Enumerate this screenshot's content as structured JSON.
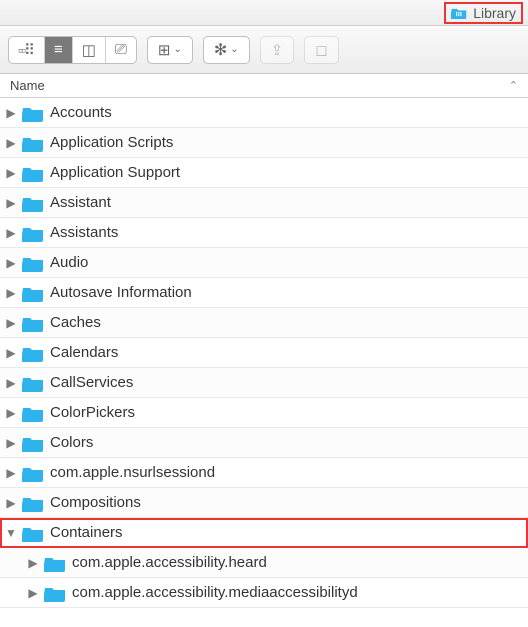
{
  "title": "Library",
  "colors": {
    "folder": "#2fb3ec",
    "accent": "#e33",
    "toolbar_icon": "#666"
  },
  "toolbar": {
    "views": [
      {
        "name": "icon-view",
        "active": false
      },
      {
        "name": "list-view",
        "active": true
      },
      {
        "name": "column-view",
        "active": false
      },
      {
        "name": "coverflow-view",
        "active": false
      }
    ],
    "arrange": {
      "name": "arrange-button"
    },
    "action": {
      "name": "action-button"
    },
    "share": {
      "name": "share-button",
      "disabled": true
    },
    "tags": {
      "name": "tags-button",
      "disabled": true
    }
  },
  "header": {
    "name_label": "Name"
  },
  "rows": [
    {
      "label": "Accounts",
      "depth": 0,
      "expanded": false
    },
    {
      "label": "Application Scripts",
      "depth": 0,
      "expanded": false
    },
    {
      "label": "Application Support",
      "depth": 0,
      "expanded": false
    },
    {
      "label": "Assistant",
      "depth": 0,
      "expanded": false
    },
    {
      "label": "Assistants",
      "depth": 0,
      "expanded": false
    },
    {
      "label": "Audio",
      "depth": 0,
      "expanded": false
    },
    {
      "label": "Autosave Information",
      "depth": 0,
      "expanded": false
    },
    {
      "label": "Caches",
      "depth": 0,
      "expanded": false
    },
    {
      "label": "Calendars",
      "depth": 0,
      "expanded": false
    },
    {
      "label": "CallServices",
      "depth": 0,
      "expanded": false
    },
    {
      "label": "ColorPickers",
      "depth": 0,
      "expanded": false
    },
    {
      "label": "Colors",
      "depth": 0,
      "expanded": false
    },
    {
      "label": "com.apple.nsurlsessiond",
      "depth": 0,
      "expanded": false
    },
    {
      "label": "Compositions",
      "depth": 0,
      "expanded": false
    },
    {
      "label": "Containers",
      "depth": 0,
      "expanded": true,
      "highlight": true
    },
    {
      "label": "com.apple.accessibility.heard",
      "depth": 1,
      "expanded": false
    },
    {
      "label": "com.apple.accessibility.mediaaccessibilityd",
      "depth": 1,
      "expanded": false
    }
  ]
}
